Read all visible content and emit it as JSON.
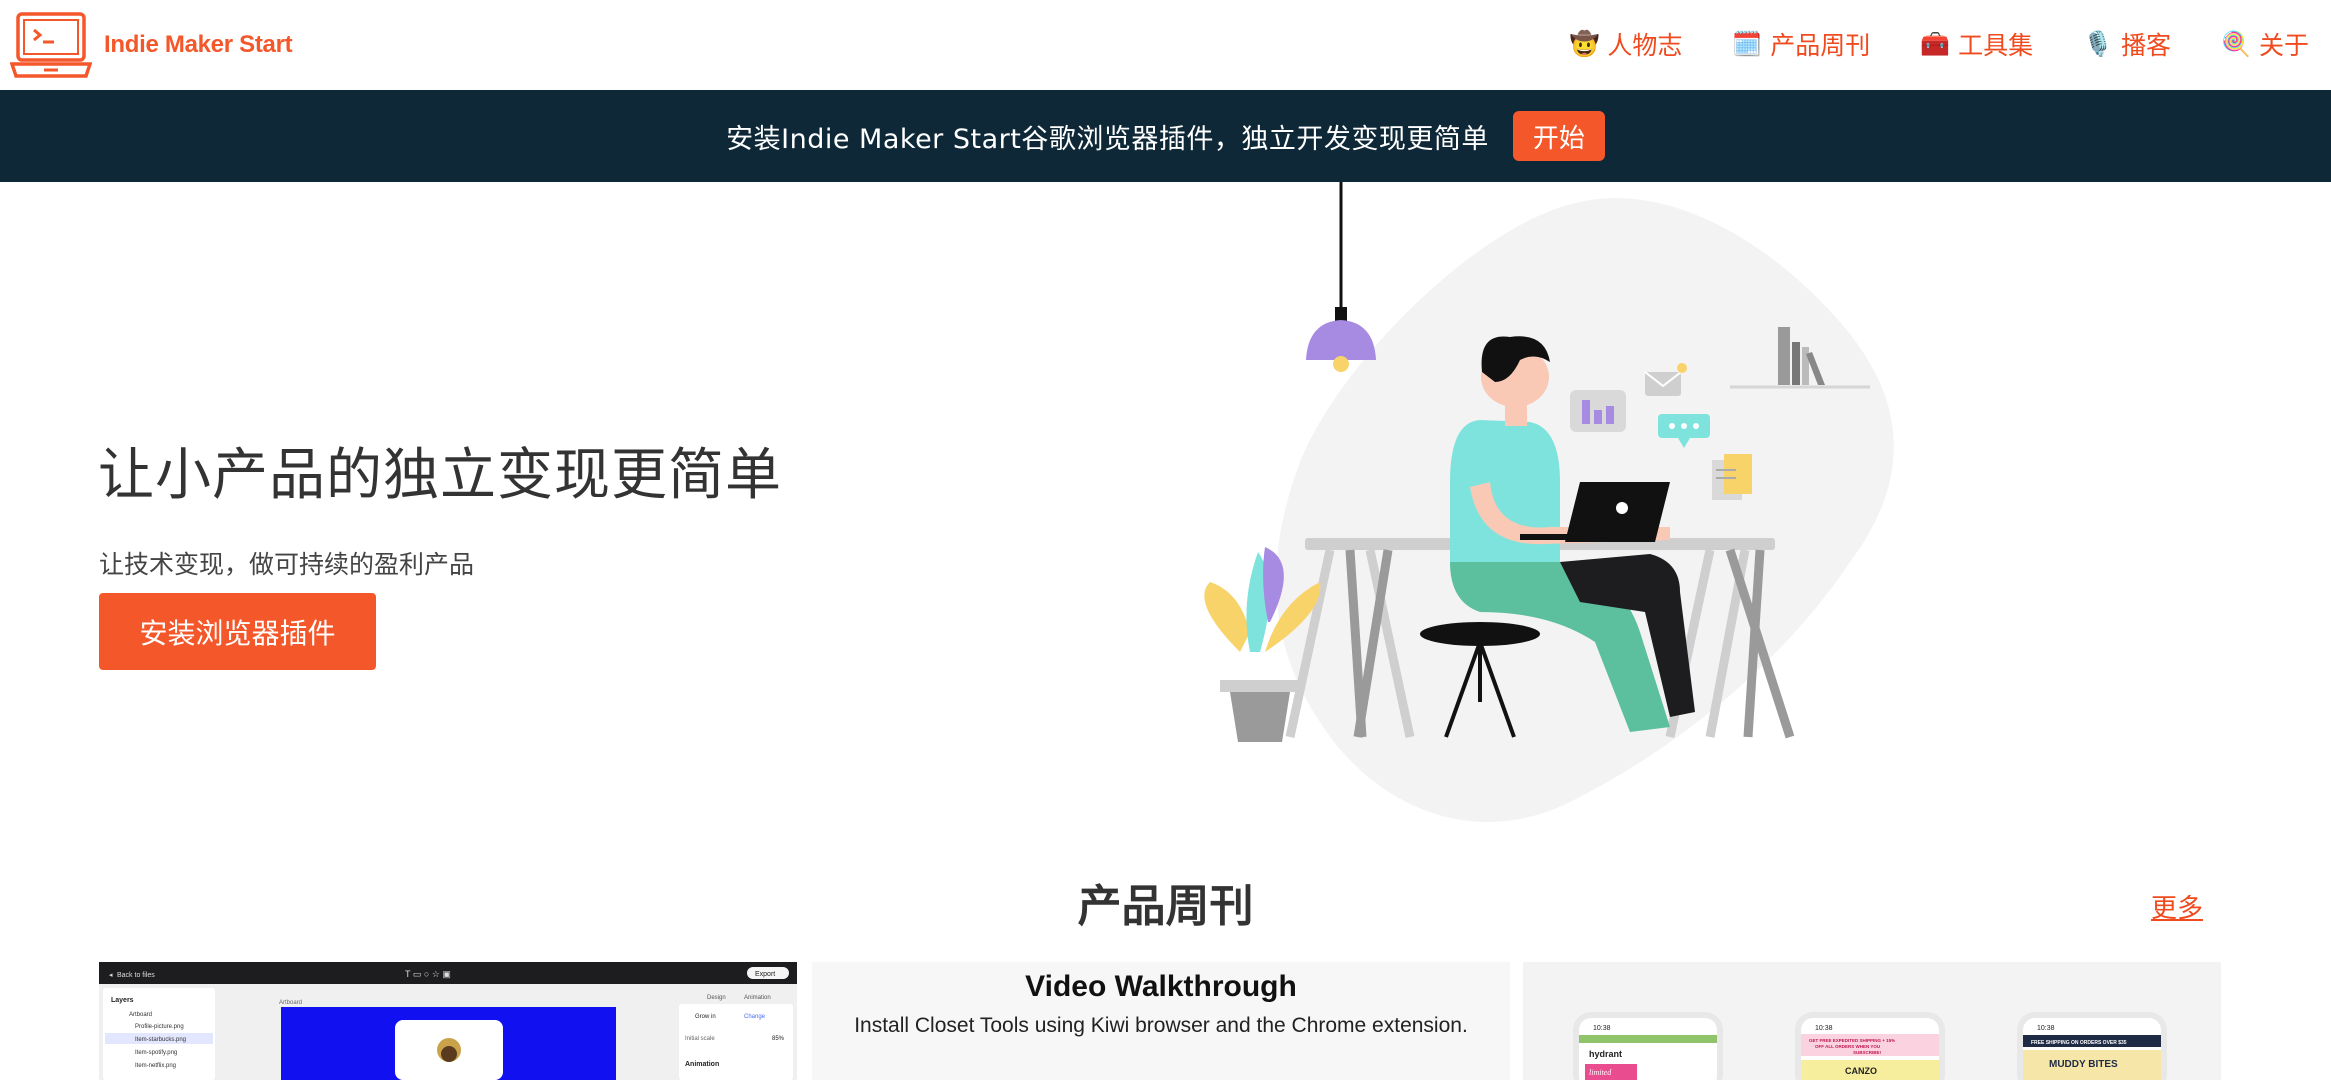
{
  "header": {
    "logo_text": "Indie Maker Start",
    "nav": [
      {
        "emoji": "🤠",
        "label": "人物志",
        "icon": "person-icon"
      },
      {
        "emoji": "🗓️",
        "label": "产品周刊",
        "icon": "calendar-icon"
      },
      {
        "emoji": "🧰",
        "label": "工具集",
        "icon": "toolbox-icon"
      },
      {
        "emoji": "🎙️",
        "label": "播客",
        "icon": "microphone-icon"
      },
      {
        "emoji": "🍭",
        "label": "关于",
        "icon": "lollipop-icon"
      }
    ]
  },
  "banner": {
    "text": "安装Indie Maker Start谷歌浏览器插件，独立开发变现更简单",
    "button": "开始"
  },
  "hero": {
    "title": "让小产品的独立变现更简单",
    "subtitle": "让技术变现，做可持续的盈利产品",
    "button": "安装浏览器插件"
  },
  "weekly": {
    "title": "产品周刊",
    "more": "更多",
    "cards": [
      {
        "name": "design-tool-preview",
        "toolbar_left": "Back to files",
        "export": "Export",
        "tabs": [
          "Design",
          "Animation"
        ],
        "layers_title": "Layers",
        "layers": [
          "Artboard",
          "Profile-picture.png",
          "Item-starbucks.png",
          "Item-spotify.png",
          "Item-netflix.png"
        ],
        "artboard_label": "Artboard",
        "panel_rows": [
          "Grow in",
          "Change",
          "Initial scale",
          "85%",
          "Animation"
        ]
      },
      {
        "name": "video-walkthrough",
        "title": "Video Walkthrough",
        "subtitle": "Install Closet Tools using Kiwi browser and the Chrome extension."
      },
      {
        "name": "mobile-store-previews",
        "phones": [
          {
            "time": "10:38",
            "brand": "hydrant",
            "tag": "limited"
          },
          {
            "time": "10:38",
            "promo": "GET FREE EXPEDITED SHIPPING + 15% OFF ALL ORDERS WHEN YOU SUBSCRIBE!",
            "brand": "CANZO"
          },
          {
            "time": "10:38",
            "promo": "FREE SHIPPING ON ORDERS OVER $35",
            "brand": "MUDDY BITES"
          }
        ]
      }
    ]
  },
  "colors": {
    "accent": "#f4572a",
    "banner_bg": "#0e2838",
    "text": "#333333"
  }
}
